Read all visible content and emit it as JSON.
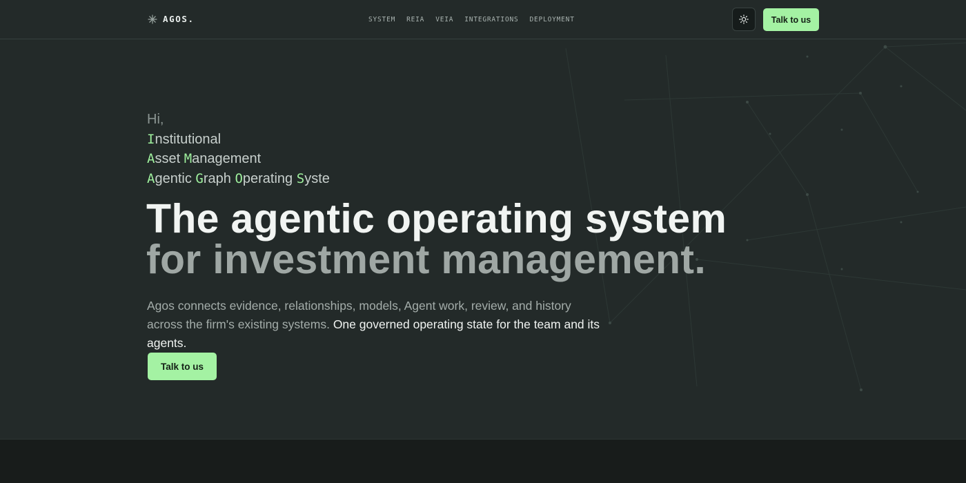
{
  "brand": {
    "name": "AGOS.",
    "icon": "asterisk-logo-icon"
  },
  "nav": {
    "items": [
      {
        "label": "SYSTEM"
      },
      {
        "label": "REIA"
      },
      {
        "label": "VEIA"
      },
      {
        "label": "INTEGRATIONS"
      },
      {
        "label": "DEPLOYMENT"
      }
    ]
  },
  "header": {
    "theme_toggle_icon": "sun-icon",
    "cta_label": "Talk to us"
  },
  "hero": {
    "greeting": "Hi,",
    "acronym_lines": [
      {
        "initial": "I",
        "rest": "nstitutional"
      },
      {
        "parts": [
          {
            "initial": "A",
            "rest": "sset "
          },
          {
            "initial": "M",
            "rest": "anagement"
          }
        ]
      },
      {
        "parts": [
          {
            "initial": "A",
            "rest": "gentic "
          },
          {
            "initial": "G",
            "rest": "raph "
          },
          {
            "initial": "O",
            "rest": "perating "
          },
          {
            "initial": "S",
            "rest": "yste"
          }
        ]
      }
    ],
    "headline_line1": "The agentic operating system",
    "headline_line2": "for investment management.",
    "lede_muted": "Agos connects evidence, relationships, models, Agent work, review, and history across the firm's existing systems.",
    "lede_strong": "One governed operating state for the team and its agents.",
    "cta_label": "Talk to us"
  },
  "colors": {
    "background": "#232a29",
    "accent": "#a4f2a3",
    "accent_text": "#9ef09d",
    "headline": "#f1f4f2",
    "headline_muted": "#9fa7a4"
  }
}
